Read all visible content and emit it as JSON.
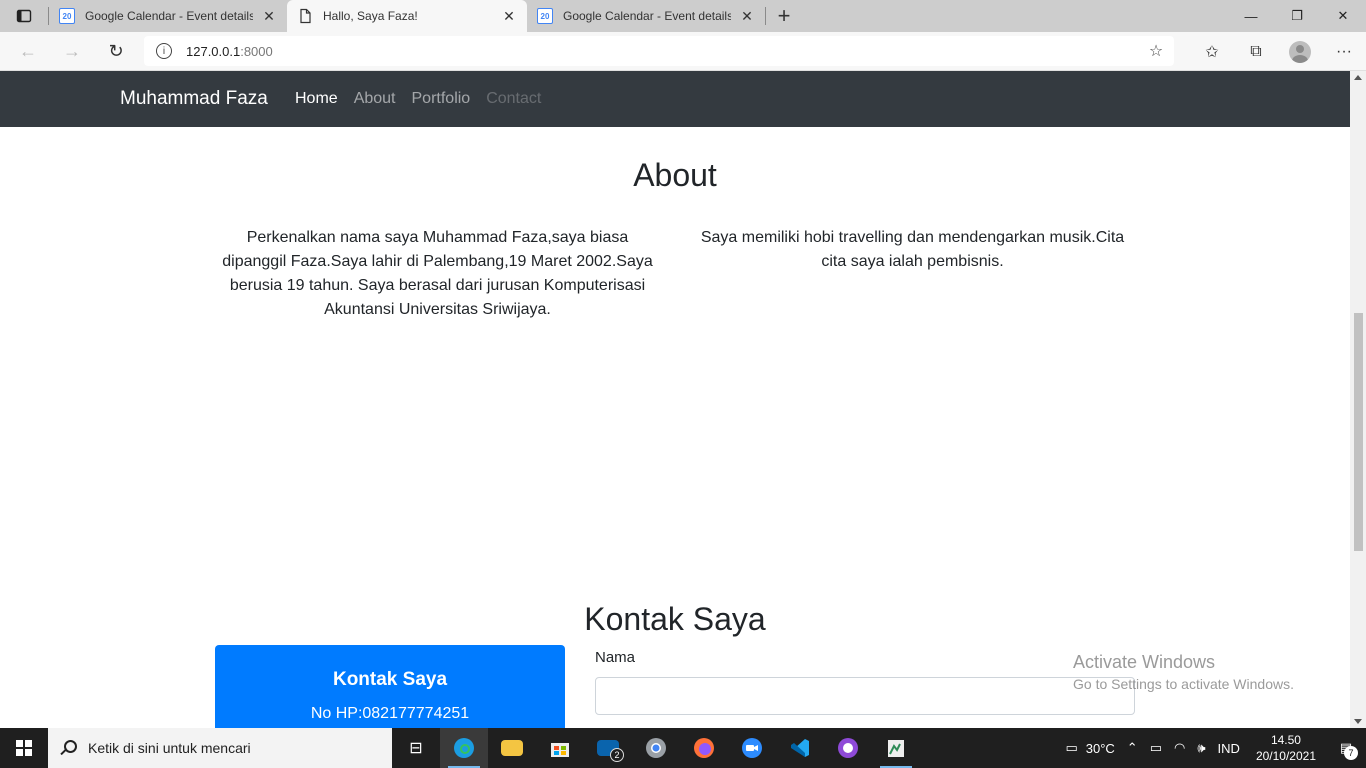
{
  "browser": {
    "tabs": [
      {
        "title": "Google Calendar - Event details",
        "favicon": "google-calendar-icon",
        "favicon_text": "20",
        "active": false
      },
      {
        "title": "Hallo, Saya Faza!",
        "favicon": "page-icon",
        "active": true
      },
      {
        "title": "Google Calendar - Event details",
        "favicon": "google-calendar-icon",
        "favicon_text": "20",
        "active": false
      }
    ],
    "address": {
      "host": "127.0.0.1",
      "port": ":8000"
    }
  },
  "site": {
    "nav": {
      "brand": "Muhammad Faza",
      "links": [
        "Home",
        "About",
        "Portfolio",
        "Contact"
      ]
    },
    "about": {
      "title": "About",
      "left_text": "Perkenalkan nama saya Muhammad Faza,saya biasa dipanggil Faza.Saya lahir di Palembang,19 Maret 2002.Saya berusia 19 tahun. Saya berasal dari jurusan Komputerisasi Akuntansi Universitas Sriwijaya.",
      "right_text": "Saya memiliki hobi travelling dan mendengarkan musik.Cita cita saya ialah pembisnis."
    },
    "contact": {
      "title": "Kontak Saya",
      "card_title": "Kontak Saya",
      "card_phone": "No HP:082177774251",
      "form_label": "Nama",
      "form_value": ""
    }
  },
  "watermark": {
    "line1": "Activate Windows",
    "line2": "Go to Settings to activate Windows."
  },
  "taskbar": {
    "search_placeholder": "Ketik di sini untuk mencari",
    "mail_badge": "2",
    "weather": "30°C",
    "language": "IND",
    "time": "14.50",
    "date": "20/10/2021",
    "notification_count": "7"
  },
  "colors": {
    "navbar_bg": "#343a40",
    "primary": "#007bff",
    "taskbar_bg": "#1f1f1f"
  }
}
